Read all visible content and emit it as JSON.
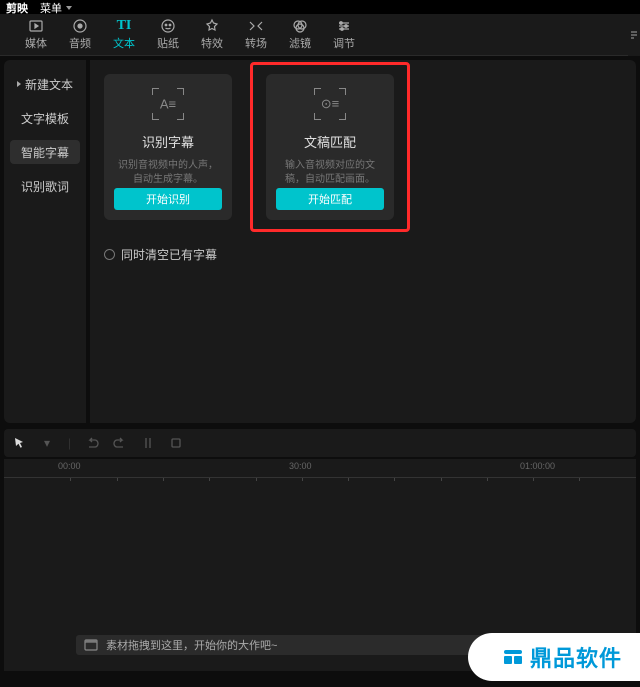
{
  "app": {
    "name": "剪映",
    "menu_label": "菜单"
  },
  "topnav": [
    {
      "label": "媒体"
    },
    {
      "label": "音频"
    },
    {
      "label": "文本",
      "icon": "TI",
      "active": true
    },
    {
      "label": "贴纸"
    },
    {
      "label": "特效"
    },
    {
      "label": "转场"
    },
    {
      "label": "滤镜"
    },
    {
      "label": "调节"
    }
  ],
  "sidebar": [
    {
      "label": "新建文本",
      "expandable": true
    },
    {
      "label": "文字模板"
    },
    {
      "label": "智能字幕",
      "active": true
    },
    {
      "label": "识别歌词"
    }
  ],
  "cards": [
    {
      "icon_text": "A≡",
      "title": "识别字幕",
      "desc": "识别音视频中的人声，自动生成字幕。",
      "button": "开始识别"
    },
    {
      "icon_text": "⊙≡",
      "title": "文稿匹配",
      "desc": "输入音视频对应的文稿，自动匹配画面。",
      "button": "开始匹配",
      "highlighted": true
    }
  ],
  "clear_subtitle_label": "同时清空已有字幕",
  "ruler_ticks": [
    "00:00",
    "30:00",
    "01:00:00"
  ],
  "track_hint": "素材拖拽到这里，开始你的大作吧~",
  "watermark": "鼎品软件"
}
